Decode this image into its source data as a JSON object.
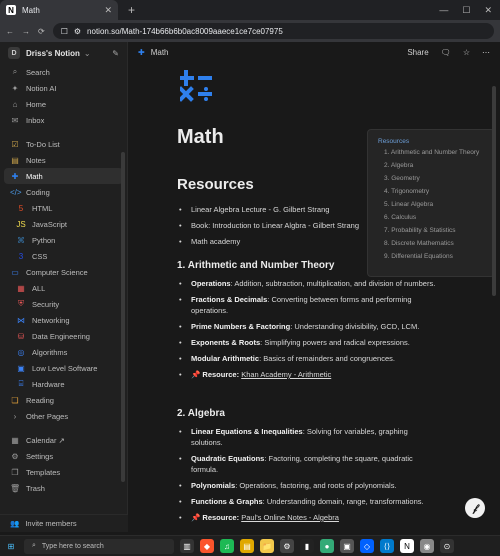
{
  "browser": {
    "tab_title": "Math",
    "tab_favicon_letter": "N",
    "new_tab_symbol": "+",
    "address": "notion.so/Math-174b66b6b0ac8009aaece1ce7ce07975"
  },
  "sidebar": {
    "workspace": "Driss's Notion",
    "workspace_badge": "D",
    "top_items": [
      {
        "label": "Search",
        "icon": "search-icon"
      },
      {
        "label": "Notion AI",
        "icon": "sparkle-icon"
      },
      {
        "label": "Home",
        "icon": "home-icon"
      },
      {
        "label": "Inbox",
        "icon": "inbox-icon"
      }
    ],
    "pages": [
      {
        "label": "To-Do List",
        "icon": "todo-icon",
        "indent": false
      },
      {
        "label": "Notes",
        "icon": "notes-icon",
        "indent": false
      },
      {
        "label": "Math",
        "icon": "math-icon",
        "indent": false,
        "active": true
      },
      {
        "label": "Coding",
        "icon": "code-icon",
        "indent": false
      },
      {
        "label": "HTML",
        "icon": "html-icon",
        "indent": true
      },
      {
        "label": "JavaScript",
        "icon": "javascript-icon",
        "indent": true
      },
      {
        "label": "Python",
        "icon": "python-icon",
        "indent": true
      },
      {
        "label": "CSS",
        "icon": "css-icon",
        "indent": true
      },
      {
        "label": "Computer Science",
        "icon": "computer-icon",
        "indent": false
      },
      {
        "label": "ALL",
        "icon": "grid-icon",
        "indent": true
      },
      {
        "label": "Security",
        "icon": "security-icon",
        "indent": true
      },
      {
        "label": "Networking",
        "icon": "network-icon",
        "indent": true
      },
      {
        "label": "Data Engineering",
        "icon": "database-icon",
        "indent": true
      },
      {
        "label": "Algorithms",
        "icon": "algorithm-icon",
        "indent": true
      },
      {
        "label": "Low Level Software",
        "icon": "chip-icon",
        "indent": true
      },
      {
        "label": "Hardware",
        "icon": "hardware-icon",
        "indent": true
      },
      {
        "label": "Reading",
        "icon": "book-icon",
        "indent": false
      },
      {
        "label": "Other Pages",
        "icon": "pages-icon",
        "indent": false
      }
    ],
    "bottom_items": [
      {
        "label": "Calendar ↗",
        "icon": "calendar-icon"
      },
      {
        "label": "Settings",
        "icon": "settings-icon"
      },
      {
        "label": "Templates",
        "icon": "templates-icon"
      },
      {
        "label": "Trash",
        "icon": "trash-icon"
      }
    ],
    "invite": "Invite members"
  },
  "topbar": {
    "breadcrumb": "Math",
    "share": "Share"
  },
  "page": {
    "title": "Math",
    "resources_heading": "Resources",
    "resources": [
      "Linear Algebra Lecture - G. Gilbert Strang",
      "Book: Introduction to Linear Algbra - Gilbert Strang",
      "Math academy"
    ],
    "section1_heading": "1. Arithmetic and Number Theory",
    "section1": [
      {
        "bold": "Operations",
        "text": ": Addition, subtraction, multiplication, and division of numbers."
      },
      {
        "bold": "Fractions & Decimals",
        "text": ": Converting between forms and performing operations."
      },
      {
        "bold": "Prime Numbers & Factoring",
        "text": ": Understanding divisibility, GCD, LCM."
      },
      {
        "bold": "Exponents & Roots",
        "text": ": Simplifying powers and radical expressions."
      },
      {
        "bold": "Modular Arithmetic",
        "text": ": Basics of remainders and congruences."
      }
    ],
    "section1_resource_label": "📌 Resource:",
    "section1_resource_link": "Khan Academy - Arithmetic",
    "section2_heading": "2. Algebra",
    "section2": [
      {
        "bold": "Linear Equations & Inequalities",
        "text": ": Solving for variables, graphing solutions."
      },
      {
        "bold": "Quadratic Equations",
        "text": ": Factoring, completing the square, quadratic formula."
      },
      {
        "bold": "Polynomials",
        "text": ": Operations, factoring, and roots of polynomials."
      },
      {
        "bold": "Functions & Graphs",
        "text": ": Understanding domain, range, transformations."
      }
    ],
    "section2_resource_label": "📌 Resource:",
    "section2_resource_link": "Paul's Online Notes - Algebra"
  },
  "toc": {
    "title": "Resources",
    "items": [
      "1. Arithmetic and Number Theory",
      "2. Algebra",
      "3. Geometry",
      "4. Trigonometry",
      "5. Linear Algebra",
      "6. Calculus",
      "7. Probability & Statistics",
      "8. Discrete Mathematics",
      "9. Differential Equations"
    ]
  },
  "taskbar": {
    "search_placeholder": "Type here to search"
  },
  "colors": {
    "accent_blue": "#2f80ed",
    "toc_link": "#6d9fd8"
  }
}
